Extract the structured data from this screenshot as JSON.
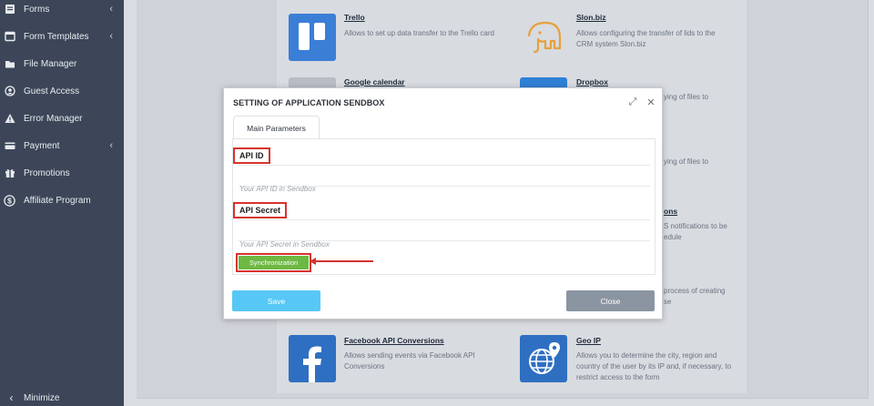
{
  "sidebar": {
    "items": [
      {
        "label": "Forms",
        "icon": "forms-icon",
        "chevron": "‹"
      },
      {
        "label": "Form Templates",
        "icon": "form-templates-icon",
        "chevron": "‹"
      },
      {
        "label": "File Manager",
        "icon": "file-manager-icon",
        "chevron": ""
      },
      {
        "label": "Guest Access",
        "icon": "guest-access-icon",
        "chevron": ""
      },
      {
        "label": "Error Manager",
        "icon": "warning-icon",
        "chevron": ""
      },
      {
        "label": "Payment",
        "icon": "payment-icon",
        "chevron": "‹"
      },
      {
        "label": "Promotions",
        "icon": "gift-icon",
        "chevron": ""
      },
      {
        "label": "Affiliate Program",
        "icon": "dollar-icon",
        "chevron": ""
      }
    ],
    "minimize_label": "Minimize",
    "minimize_chevron": "‹"
  },
  "apps": {
    "trello": {
      "title": "Trello",
      "desc": "Allows to set up data transfer to the Trello card"
    },
    "slonbiz": {
      "title": "Slon.biz",
      "desc": "Allows configuring the transfer of lids to the CRM system Slon.biz"
    },
    "google_calendar": {
      "title": "Google calendar"
    },
    "dropbox": {
      "title": "Dropbox",
      "desc_tail": "ying of files to"
    },
    "files2": {
      "desc_tail": "ying of files to"
    },
    "notifications": {
      "title_tail": "ons",
      "desc_tail1": "S notifications to be",
      "desc_tail2": "edule"
    },
    "creating": {
      "desc_tail1": "process of creating",
      "desc_tail2": "se"
    },
    "facebook": {
      "title": "Facebook API Conversions",
      "desc": "Allows sending events via Facebook API Conversions"
    },
    "geoip": {
      "title": "Geo IP",
      "desc": "Allows you to determine the city, region and country of the user by its IP and, if necessary, to restrict access to the form"
    }
  },
  "modal": {
    "title": "SETTING OF APPLICATION SENDBOX",
    "expand_icon": "⤢",
    "close_icon": "✕",
    "tab_label": "Main Parameters",
    "api_id": {
      "label": "API ID",
      "value": "",
      "placeholder": "Your API ID in Sendbox"
    },
    "api_secret": {
      "label": "API Secret",
      "value": "",
      "placeholder": "Your API Secret in Sendbox"
    },
    "sync_label": "Synchronization",
    "save_label": "Save",
    "close_label": "Close"
  },
  "colors": {
    "sidebar_bg": "#3c4658",
    "highlight": "#d6332b",
    "sync_green": "#6db843",
    "save_blue": "#57c8f5",
    "close_gray": "#8b95a2"
  }
}
